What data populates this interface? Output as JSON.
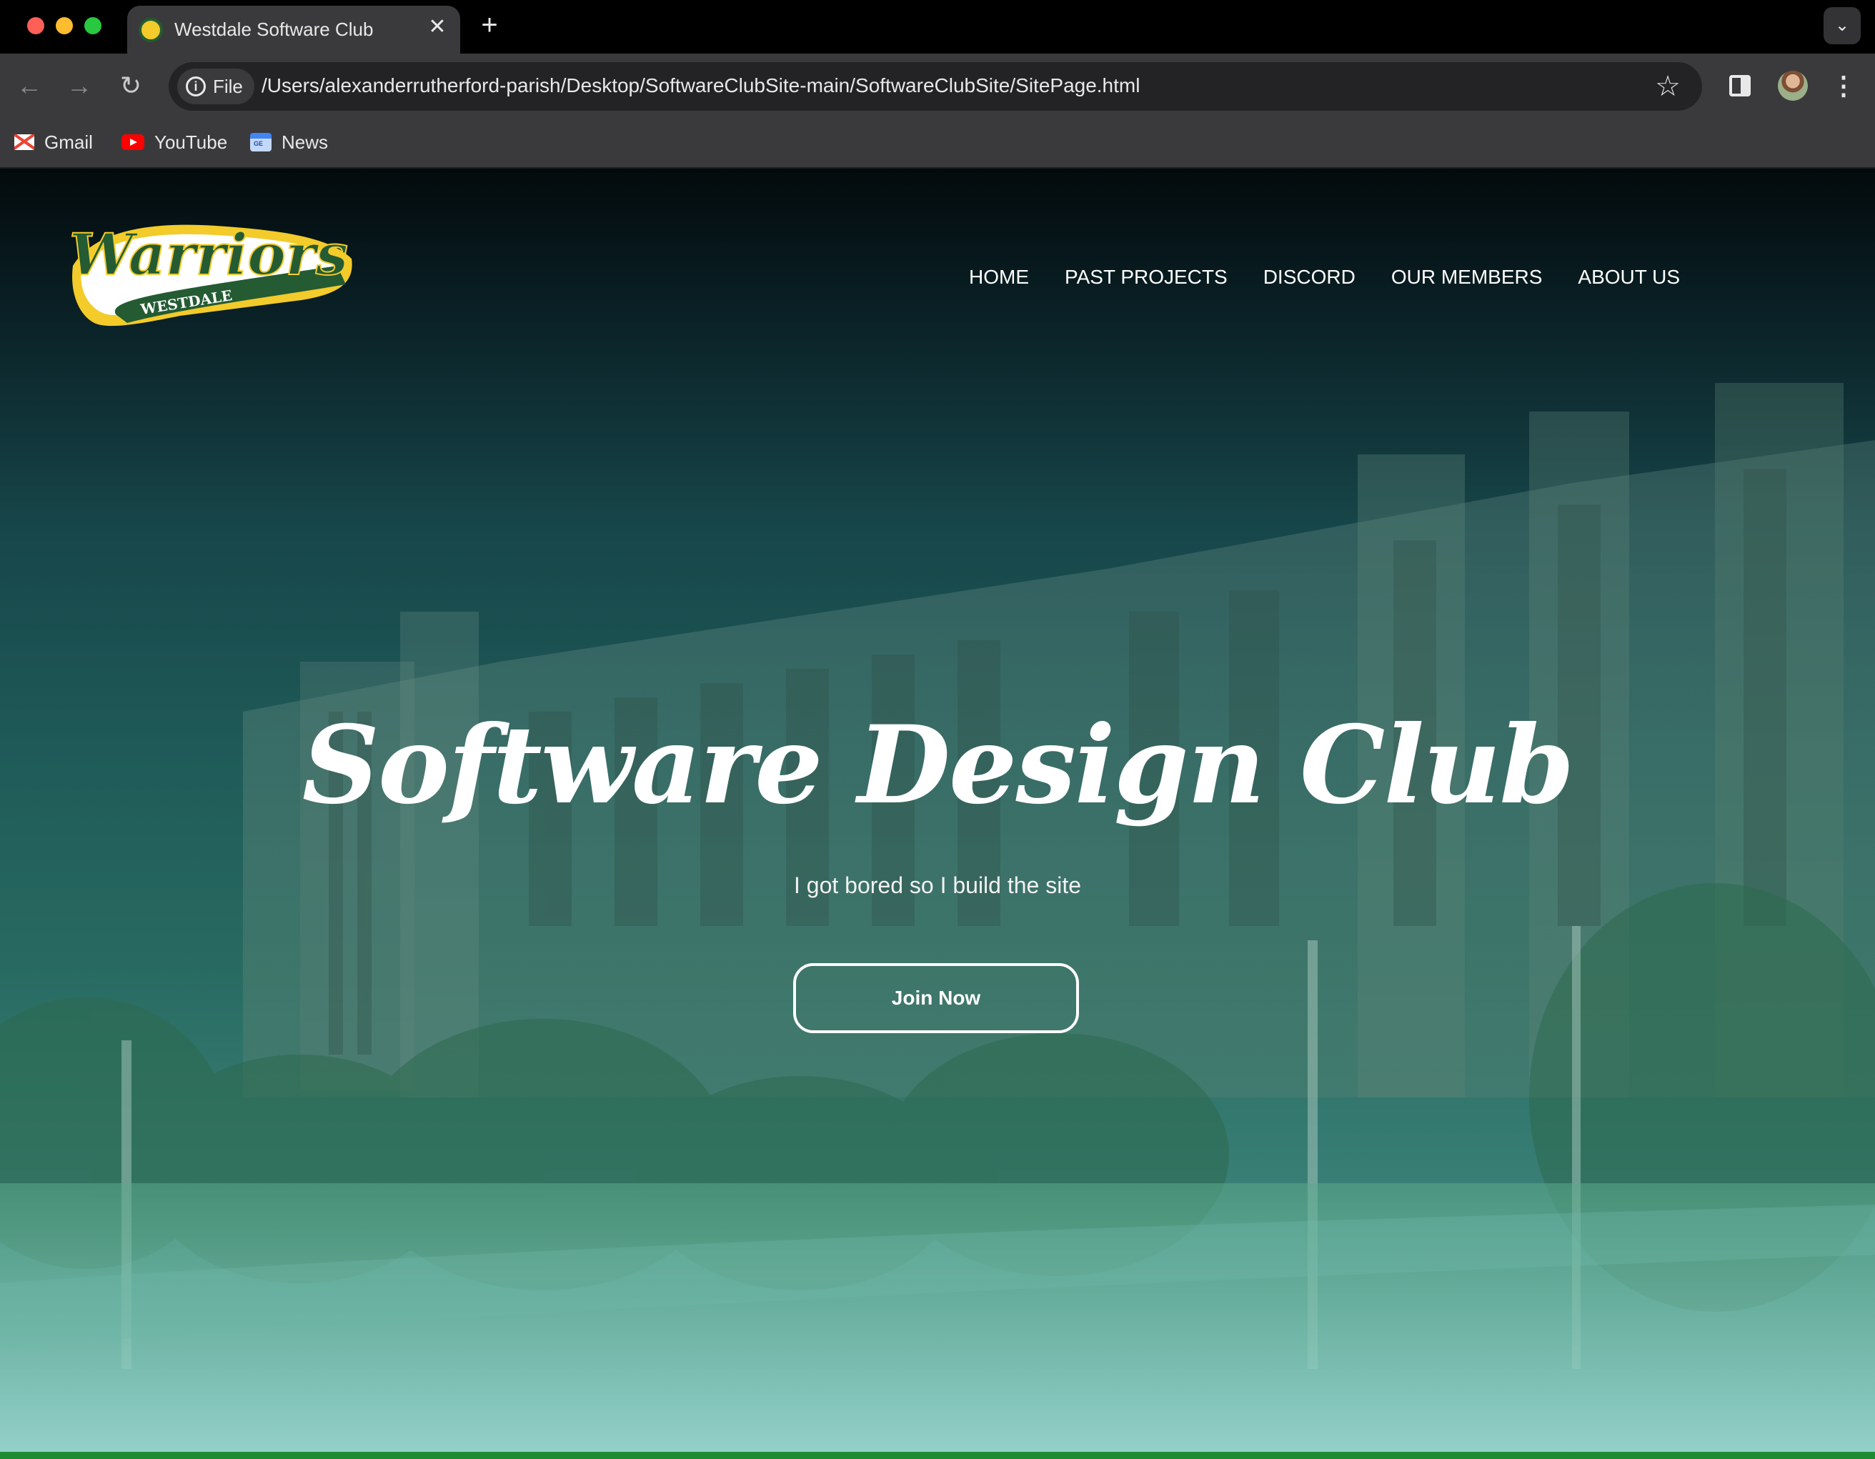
{
  "browser": {
    "tab": {
      "title": "Westdale Software Club",
      "close_glyph": "✕"
    },
    "new_tab_glyph": "+",
    "tab_menu_glyph": "⌄",
    "nav": {
      "back_glyph": "←",
      "forward_glyph": "→",
      "reload_glyph": "↻"
    },
    "omnibox": {
      "scheme_chip": "File",
      "url": "/Users/alexanderrutherford-parish/Desktop/SoftwareClubSite-main/SoftwareClubSite/SitePage.html",
      "star_glyph": "☆"
    },
    "menu_glyph": "⋮",
    "bookmarks": [
      {
        "label": "Gmail",
        "icon": "gmail-icon"
      },
      {
        "label": "YouTube",
        "icon": "youtube-icon"
      },
      {
        "label": "News",
        "icon": "google-news-icon"
      }
    ]
  },
  "site": {
    "logo": {
      "word": "Warriors",
      "sub": "WESTDALE"
    },
    "nav": [
      "HOME",
      "PAST PROJECTS",
      "DISCORD",
      "OUR MEMBERS",
      "ABOUT US"
    ],
    "hero": {
      "title": "Software Design Club",
      "subtitle": "I got bored so I build the site",
      "cta": "Join Now"
    }
  },
  "colors": {
    "brand_green": "#245b33",
    "brand_yellow": "#f3cb2a",
    "bottom_bar": "#1e8a32"
  }
}
